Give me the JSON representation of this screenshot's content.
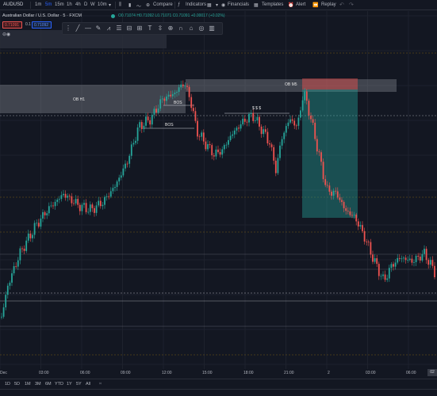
{
  "toolbar": {
    "symbol": "AUDUSD",
    "timeframes": [
      "1m",
      "5m",
      "15m",
      "1h",
      "4h",
      "D",
      "W",
      "10m"
    ],
    "active_timeframe": "5m",
    "compare": "Compare",
    "indicators": "Indicators",
    "financials": "Financials",
    "templates": "Templates",
    "alert": "Alert",
    "replay": "Replay"
  },
  "legend": {
    "title": "Australian Dollar / U.S. Dollar · 5 · FXCM",
    "ohlc": "O0.71074 H0.71092 L0.71071 C0.71091 +0.00017 (+0.02%)",
    "sell_price": "0.71091",
    "spread": "0.1",
    "buy_price": "0.71092"
  },
  "annotations": {
    "ob_h1": "OB H1",
    "ob_m5": "OB M5",
    "bos_1": "BOS",
    "bos_2": "BOS",
    "sss": "$ $ $"
  },
  "time_axis": [
    "Dec",
    "03:00",
    "06:00",
    "09:00",
    "12:00",
    "15:00",
    "18:00",
    "21:00",
    "2",
    "03:00",
    "06:00"
  ],
  "time_now": "02",
  "bottom": {
    "ranges": [
      "1D",
      "5D",
      "1M",
      "3M",
      "6M",
      "YTD",
      "1Y",
      "5Y",
      "All"
    ]
  },
  "colors": {
    "up": "#26a69a",
    "down": "#ef5350",
    "background": "#131722",
    "zone_gray": "#9598a1",
    "zone_green": "#26a69a",
    "zone_red": "#ef5350"
  }
}
